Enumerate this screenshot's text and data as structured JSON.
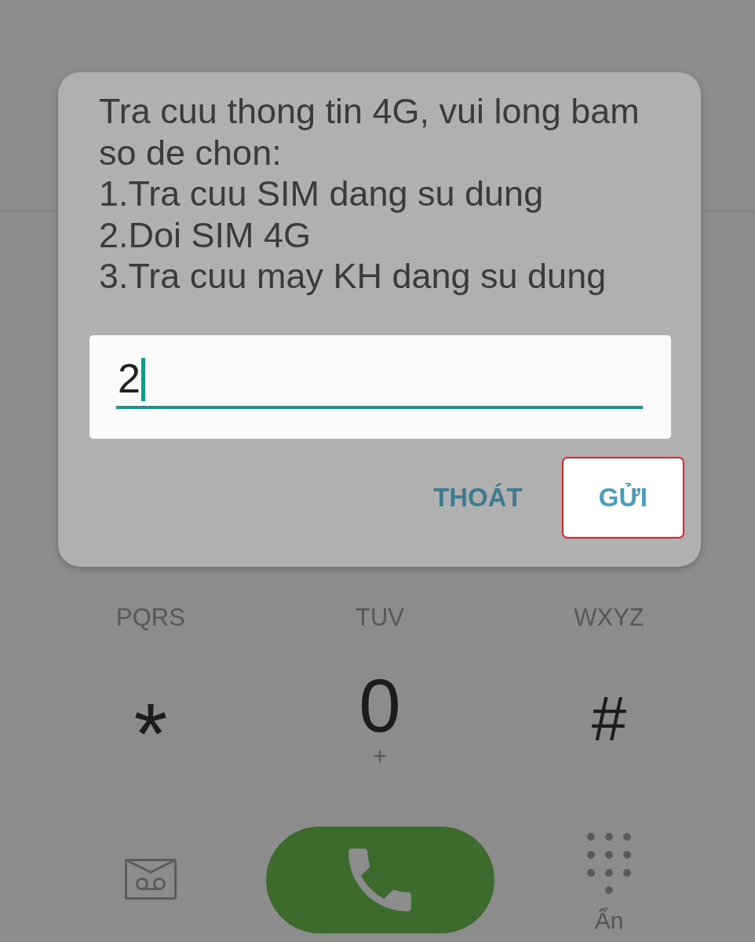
{
  "dialog": {
    "prompt": "Tra cuu thong tin 4G, vui long bam so de chon:",
    "options": [
      "1.Tra cuu SIM dang su dung",
      "2.Doi SIM 4G",
      "3.Tra cuu may KH dang su dung"
    ],
    "input": {
      "value": "2",
      "focused": true
    },
    "buttons": [
      {
        "label": "THOÁT",
        "highlighted": false
      },
      {
        "label": "GỬI",
        "highlighted": true
      }
    ]
  },
  "keypad": {
    "keys": [
      {
        "kind": "digit",
        "letters": "PQRS"
      },
      {
        "kind": "digit",
        "letters": "TUV"
      },
      {
        "kind": "digit",
        "letters": "WXYZ"
      },
      {
        "kind": "star",
        "label": "*"
      },
      {
        "kind": "digit",
        "label": "0",
        "letters": "+"
      },
      {
        "kind": "symbol",
        "label": "#"
      }
    ]
  },
  "action_bar": {
    "keypad_toggle_label": "Ẩn"
  }
}
